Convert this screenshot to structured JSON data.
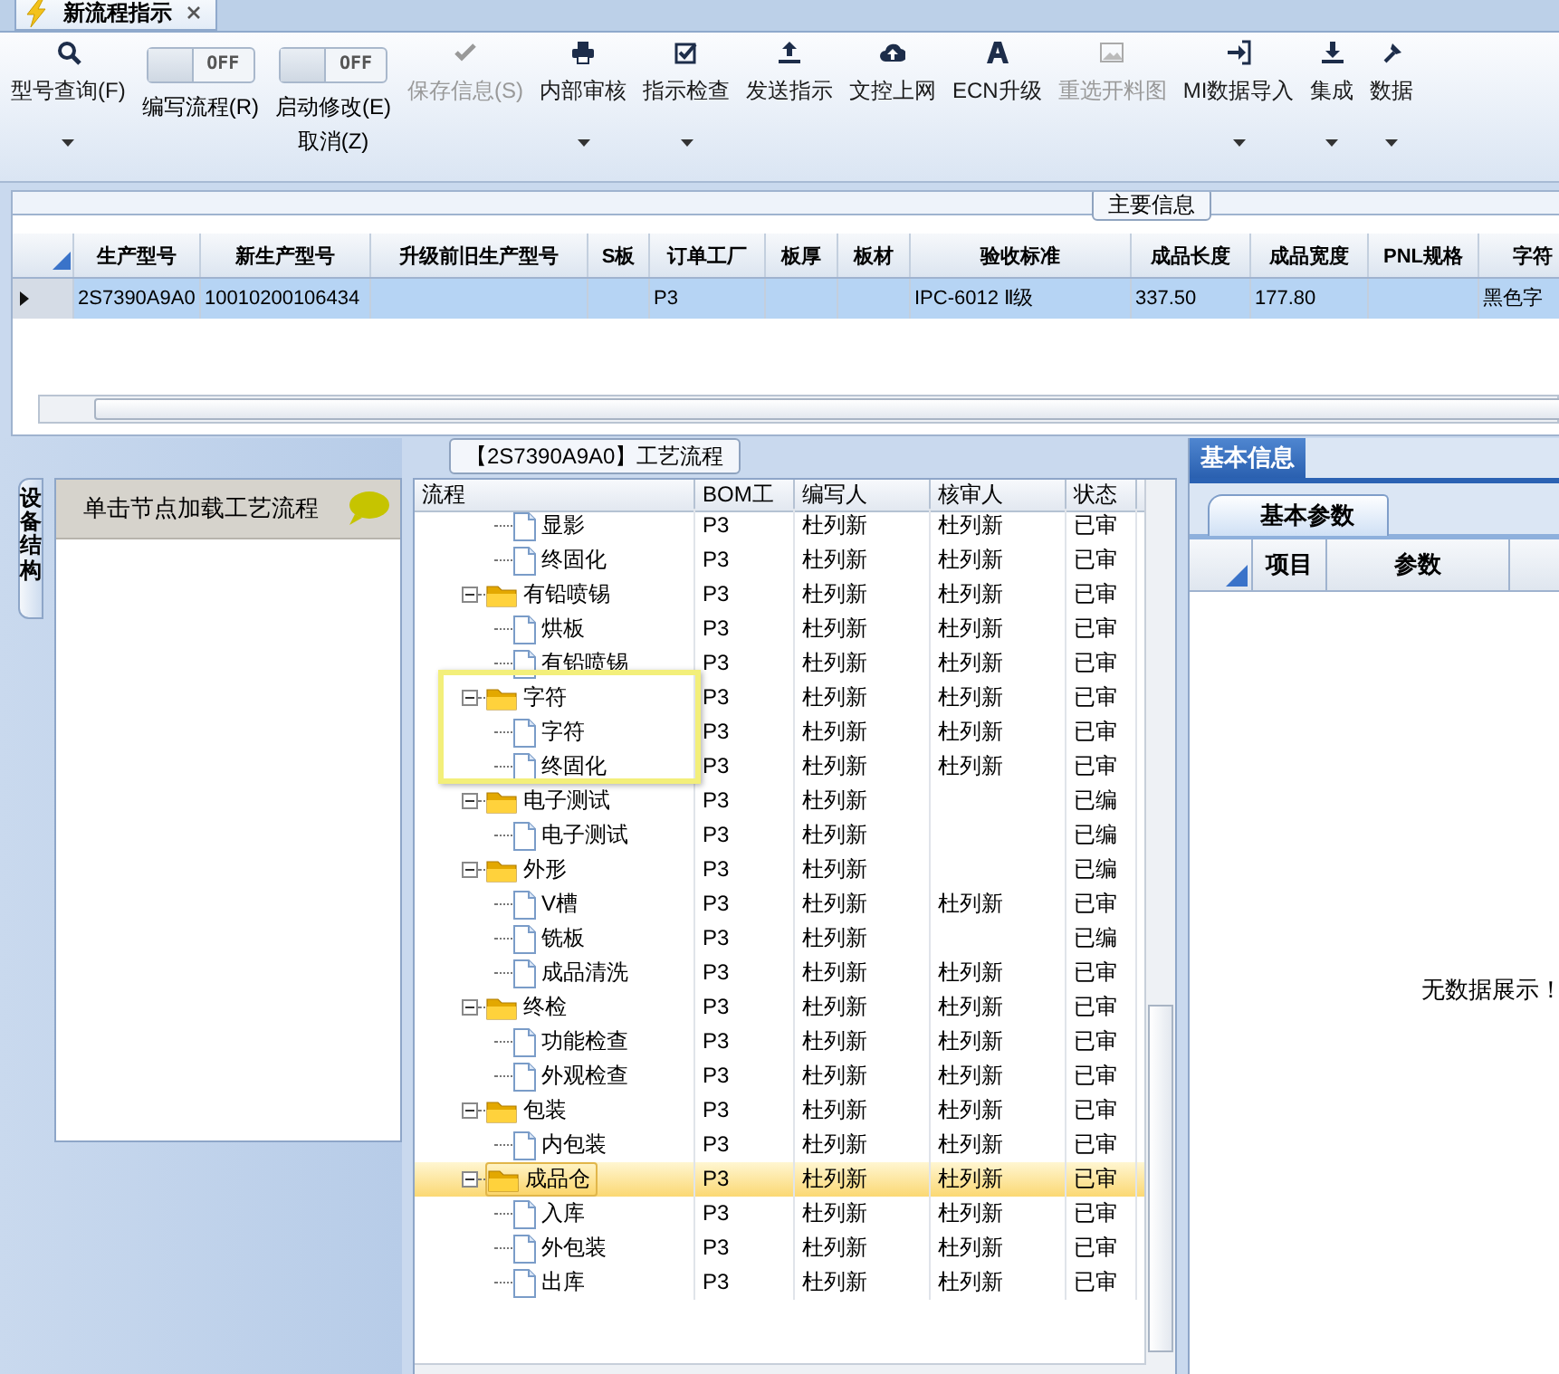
{
  "document_tab": {
    "title": "新流程指示"
  },
  "toolbar": [
    {
      "kind": "button",
      "label": "型号查询(F)",
      "disabled": false,
      "has_menu": true
    },
    {
      "kind": "toggle",
      "label": "编写流程(R)",
      "state_text": "OFF",
      "on": false
    },
    {
      "kind": "toggle",
      "label": "启动修改(E)",
      "sublabel": "取消(Z)",
      "state_text": "OFF",
      "on": false
    },
    {
      "kind": "button",
      "label": "保存信息(S)",
      "disabled": true,
      "has_menu": false
    },
    {
      "kind": "button",
      "label": "内部审核",
      "disabled": false,
      "has_menu": true
    },
    {
      "kind": "button",
      "label": "指示检查",
      "disabled": false,
      "has_menu": true
    },
    {
      "kind": "button",
      "label": "发送指示",
      "disabled": false,
      "has_menu": false
    },
    {
      "kind": "button",
      "label": "文控上网",
      "disabled": false,
      "has_menu": false
    },
    {
      "kind": "button",
      "label": "ECN升级",
      "disabled": false,
      "has_menu": false
    },
    {
      "kind": "button",
      "label": "重选开料图",
      "disabled": true,
      "has_menu": false
    },
    {
      "kind": "button",
      "label": "MI数据导入",
      "disabled": false,
      "has_menu": true
    },
    {
      "kind": "button",
      "label": "集成",
      "disabled": false,
      "has_menu": true
    },
    {
      "kind": "button",
      "label": "数据",
      "disabled": false,
      "has_menu": true
    }
  ],
  "main_info": {
    "title": "主要信息",
    "columns": [
      "生产型号",
      "新生产型号",
      "升级前旧生产型号",
      "S板",
      "订单工厂",
      "板厚",
      "板材",
      "验收标准",
      "成品长度",
      "成品宽度",
      "PNL规格",
      "字符"
    ],
    "rows": [
      {
        "selected": true,
        "cells": [
          "2S7390A9A0",
          "10010200106434",
          "",
          "",
          "P3",
          "",
          "",
          "IPC-6012 Ⅱ级",
          "337.50",
          "177.80",
          "",
          "黑色字"
        ]
      }
    ]
  },
  "side_panel": {
    "tab": "设备结构",
    "header": "单击节点加载工艺流程"
  },
  "flow": {
    "title": "【2S7390A9A0】工艺流程",
    "columns": [
      "流程",
      "BOM工",
      "编写人",
      "核审人",
      "状态"
    ],
    "continued_children": [
      {
        "label": "显影",
        "bom": "P3",
        "writer": "杜列新",
        "reviewer": "杜列新",
        "status": "已审",
        "selected": false
      },
      {
        "label": "终固化",
        "bom": "P3",
        "writer": "杜列新",
        "reviewer": "杜列新",
        "status": "已审",
        "selected": false
      }
    ],
    "nodes": [
      {
        "label": "有铅喷锡",
        "bom": "P3",
        "writer": "杜列新",
        "reviewer": "杜列新",
        "status": "已审",
        "selected": false,
        "expanded": true,
        "children": [
          {
            "label": "烘板",
            "bom": "P3",
            "writer": "杜列新",
            "reviewer": "杜列新",
            "status": "已审",
            "selected": false
          },
          {
            "label": "有铅喷锡",
            "bom": "P3",
            "writer": "杜列新",
            "reviewer": "杜列新",
            "status": "已审",
            "selected": false
          }
        ]
      },
      {
        "label": "字符",
        "bom": "P3",
        "writer": "杜列新",
        "reviewer": "杜列新",
        "status": "已审",
        "selected": false,
        "expanded": true,
        "highlighted": true,
        "children": [
          {
            "label": "字符",
            "bom": "P3",
            "writer": "杜列新",
            "reviewer": "杜列新",
            "status": "已审",
            "selected": false
          },
          {
            "label": "终固化",
            "bom": "P3",
            "writer": "杜列新",
            "reviewer": "杜列新",
            "status": "已审",
            "selected": false
          }
        ]
      },
      {
        "label": "电子测试",
        "bom": "P3",
        "writer": "杜列新",
        "status": "已编",
        "selected": false,
        "expanded": true,
        "children": [
          {
            "label": "电子测试",
            "bom": "P3",
            "writer": "杜列新",
            "status": "已编",
            "selected": false
          }
        ]
      },
      {
        "label": "外形",
        "bom": "P3",
        "writer": "杜列新",
        "status": "已编",
        "selected": false,
        "expanded": true,
        "children": [
          {
            "label": "V槽",
            "bom": "P3",
            "writer": "杜列新",
            "reviewer": "杜列新",
            "status": "已审",
            "selected": false
          },
          {
            "label": "铣板",
            "bom": "P3",
            "writer": "杜列新",
            "status": "已编",
            "selected": false
          },
          {
            "label": "成品清洗",
            "bom": "P3",
            "writer": "杜列新",
            "reviewer": "杜列新",
            "status": "已审",
            "selected": false
          }
        ]
      },
      {
        "label": "终检",
        "bom": "P3",
        "writer": "杜列新",
        "reviewer": "杜列新",
        "status": "已审",
        "selected": false,
        "expanded": true,
        "children": [
          {
            "label": "功能检查",
            "bom": "P3",
            "writer": "杜列新",
            "reviewer": "杜列新",
            "status": "已审",
            "selected": false
          },
          {
            "label": "外观检查",
            "bom": "P3",
            "writer": "杜列新",
            "reviewer": "杜列新",
            "status": "已审",
            "selected": false
          }
        ]
      },
      {
        "label": "包装",
        "bom": "P3",
        "writer": "杜列新",
        "reviewer": "杜列新",
        "status": "已审",
        "selected": false,
        "expanded": true,
        "children": [
          {
            "label": "内包装",
            "bom": "P3",
            "writer": "杜列新",
            "reviewer": "杜列新",
            "status": "已审",
            "selected": false
          }
        ]
      },
      {
        "label": "成品仓",
        "bom": "P3",
        "writer": "杜列新",
        "reviewer": "杜列新",
        "status": "已审",
        "selected": true,
        "expanded": true,
        "children": [
          {
            "label": "入库",
            "bom": "P3",
            "writer": "杜列新",
            "reviewer": "杜列新",
            "status": "已审",
            "selected": false
          },
          {
            "label": "外包装",
            "bom": "P3",
            "writer": "杜列新",
            "reviewer": "杜列新",
            "status": "已审",
            "selected": false
          },
          {
            "label": "出库",
            "bom": "P3",
            "writer": "杜列新",
            "reviewer": "杜列新",
            "status": "已审",
            "selected": false
          }
        ]
      }
    ]
  },
  "info_panel": {
    "tab": "基本信息",
    "subtab": "基本参数",
    "columns": [
      "项目",
      "参数"
    ],
    "empty_message": "无数据展示！"
  }
}
